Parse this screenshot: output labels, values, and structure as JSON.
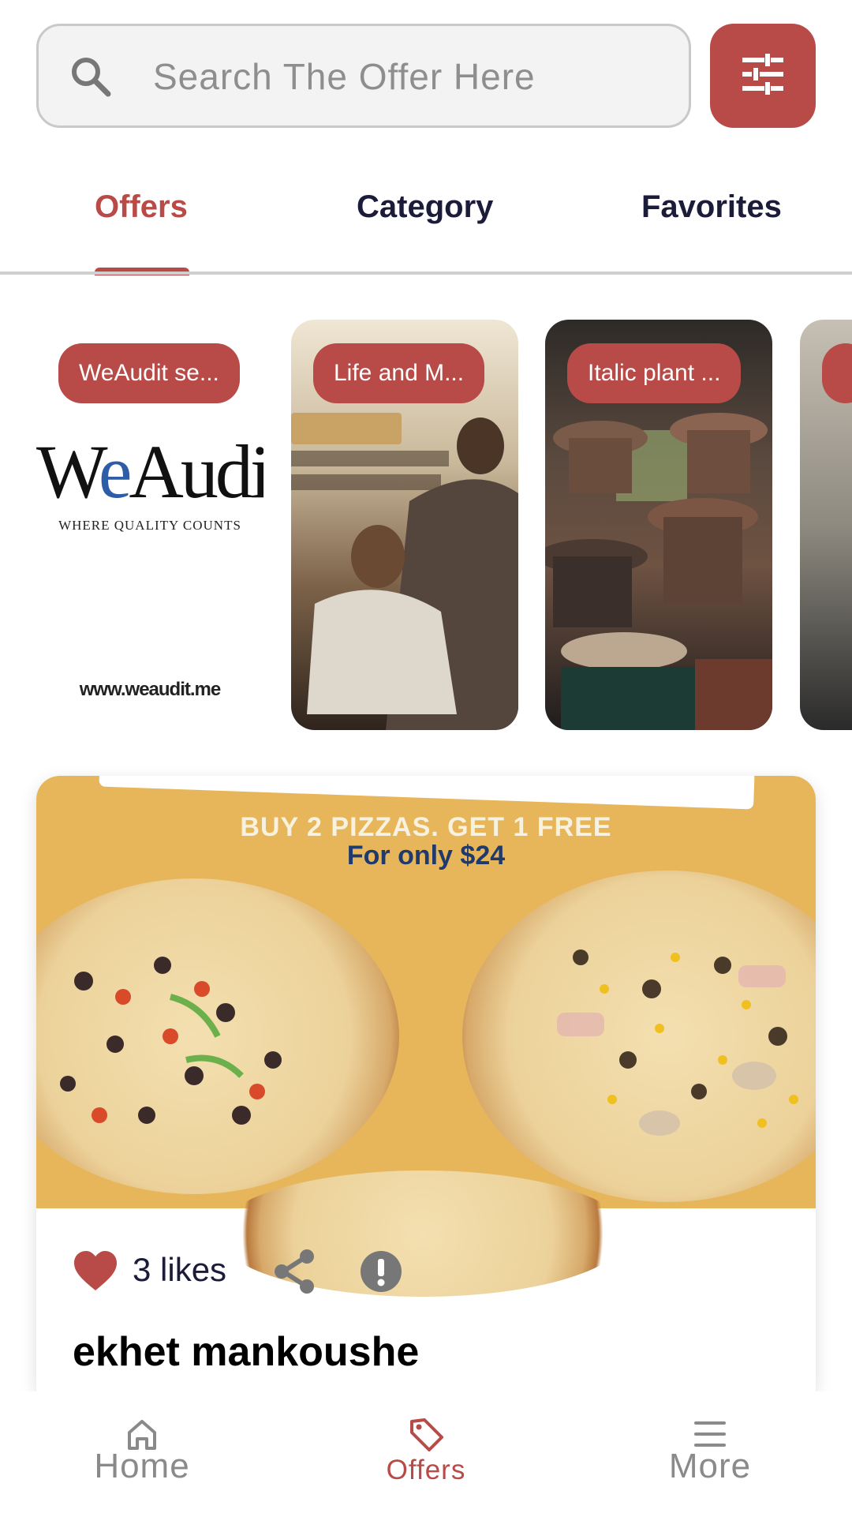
{
  "search": {
    "placeholder": "Search The Offer Here",
    "icon": "search-icon"
  },
  "filter_button": {
    "icon": "sliders-icon"
  },
  "tabs": [
    {
      "label": "Offers",
      "active": true
    },
    {
      "label": "Category",
      "active": false
    },
    {
      "label": "Favorites",
      "active": false
    }
  ],
  "stories": [
    {
      "badge": "WeAudit se...",
      "logo_name_left": "W",
      "logo_name_e": "e",
      "logo_name_right": "Audit",
      "logo_tagline": "WHERE QUALITY COUNTS",
      "logo_url": "www.weaudit.me"
    },
    {
      "badge": "Life and M..."
    },
    {
      "badge": "Italic plant ..."
    },
    {
      "badge": ""
    }
  ],
  "offer": {
    "image_text_line1": "BUY 2 PIZZAS. GET 1 FREE",
    "image_text_line2": "For only $24",
    "likes": "3 likes",
    "title": "ekhet mankoushe",
    "liked": true
  },
  "bottom_nav": [
    {
      "label": "Home",
      "icon": "home-icon",
      "active": false
    },
    {
      "label": "Offers",
      "icon": "tag-icon",
      "active": true
    },
    {
      "label": "More",
      "icon": "menu-icon",
      "active": false
    }
  ],
  "colors": {
    "accent": "#b84a47",
    "text_dark": "#1b1b3a",
    "muted": "#8a8a8a"
  }
}
